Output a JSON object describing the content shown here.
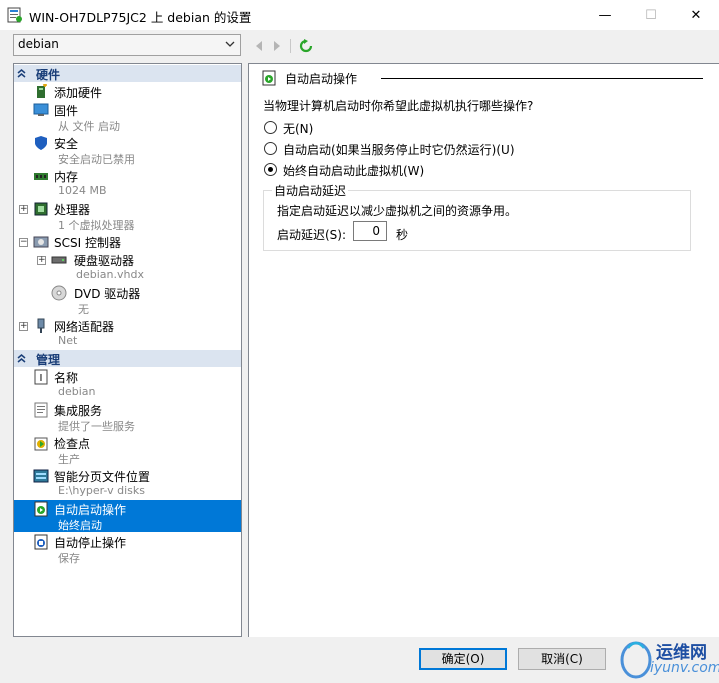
{
  "window": {
    "title": "WIN-OH7DLP75JC2 上 debian 的设置",
    "minimize": "—",
    "maximize": "☐",
    "close": "✕"
  },
  "vm_selector": {
    "value": "debian"
  },
  "nav": {
    "back_icon": "arrow-left-icon",
    "forward_icon": "arrow-right-icon",
    "refresh_icon": "refresh-icon"
  },
  "sections": {
    "hardware": "硬件",
    "management": "管理"
  },
  "hardware_items": {
    "add_hardware": {
      "name": "添加硬件"
    },
    "firmware": {
      "name": "固件",
      "sub": "从 文件 启动"
    },
    "security": {
      "name": "安全",
      "sub": "安全启动已禁用"
    },
    "memory": {
      "name": "内存",
      "sub": "1024 MB"
    },
    "processor": {
      "name": "处理器",
      "sub": "1 个虚拟处理器"
    },
    "scsi": {
      "name": "SCSI 控制器"
    },
    "hdd": {
      "name": "硬盘驱动器",
      "sub": "debian.vhdx"
    },
    "dvd": {
      "name": "DVD 驱动器",
      "sub": "无"
    },
    "network": {
      "name": "网络适配器",
      "sub": "Net"
    }
  },
  "management_items": {
    "name": {
      "name": "名称",
      "sub": "debian"
    },
    "integration": {
      "name": "集成服务",
      "sub": "提供了一些服务"
    },
    "checkpoints": {
      "name": "检查点",
      "sub": "生产"
    },
    "paging": {
      "name": "智能分页文件位置",
      "sub": "E:\\hyper-v disks"
    },
    "auto_start": {
      "name": "自动启动操作",
      "sub": "始终启动"
    },
    "auto_stop": {
      "name": "自动停止操作",
      "sub": "保存"
    }
  },
  "detail": {
    "heading": "自动启动操作",
    "question": "当物理计算机启动时你希望此虚拟机执行哪些操作?",
    "options": [
      {
        "label": "无(N)",
        "selected": false
      },
      {
        "label": "自动启动(如果当服务停止时它仍然运行)(U)",
        "selected": false
      },
      {
        "label": "始终自动启动此虚拟机(W)",
        "selected": true
      }
    ],
    "delay_group": {
      "title": "自动启动延迟",
      "description": "指定启动延迟以减少虚拟机之间的资源争用。",
      "label": "启动延迟(S):",
      "value": "0",
      "unit": "秒"
    }
  },
  "buttons": {
    "ok": "确定(O)",
    "cancel": "取消(C)"
  },
  "watermark": {
    "line1": "运维网",
    "line2": "iyunv.com"
  },
  "colors": {
    "selection": "#0078d7",
    "section_header": "#dbe4f0",
    "accent_green": "#2aa62a"
  }
}
